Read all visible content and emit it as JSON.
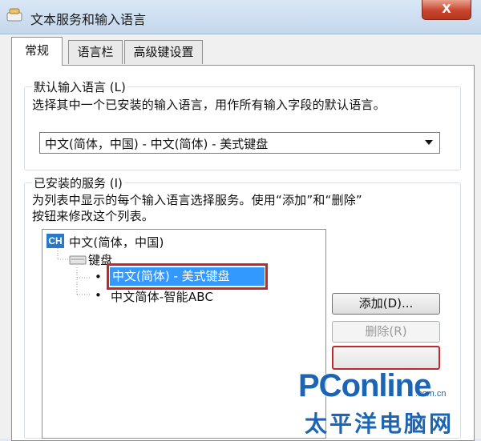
{
  "window": {
    "title": "文本服务和输入语言",
    "close_label": "X"
  },
  "tabs": [
    {
      "label": "常规",
      "active": true
    },
    {
      "label": "语言栏",
      "active": false
    },
    {
      "label": "高级键设置",
      "active": false
    }
  ],
  "default_lang": {
    "legend": "默认输入语言 (L)",
    "description": "选择其中一个已安装的输入语言，用作所有输入字段的默认语言。",
    "selected": "中文(简体，中国) - 中文(简体) - 美式键盘"
  },
  "installed": {
    "legend": "已安装的服务 (I)",
    "description_line1": "为列表中显示的每个输入语言选择服务。使用“添加”和“删除”",
    "description_line2": "按钮来修改这个列表。",
    "tree": {
      "lang_badge": "CH",
      "lang_label": "中文(简体，中国)",
      "category_label": "键盘",
      "items": [
        {
          "bullet": "•",
          "label": "中文(简体) - 美式键盘",
          "selected": true
        },
        {
          "bullet": "•",
          "label": "中文简体-智能ABC",
          "selected": false
        }
      ]
    },
    "buttons": {
      "add": "添加(D)...",
      "remove": "删除(R)"
    }
  },
  "watermark": {
    "brand": "PConline",
    "domain": ".com.cn",
    "subtitle": "太平洋电脑网"
  }
}
